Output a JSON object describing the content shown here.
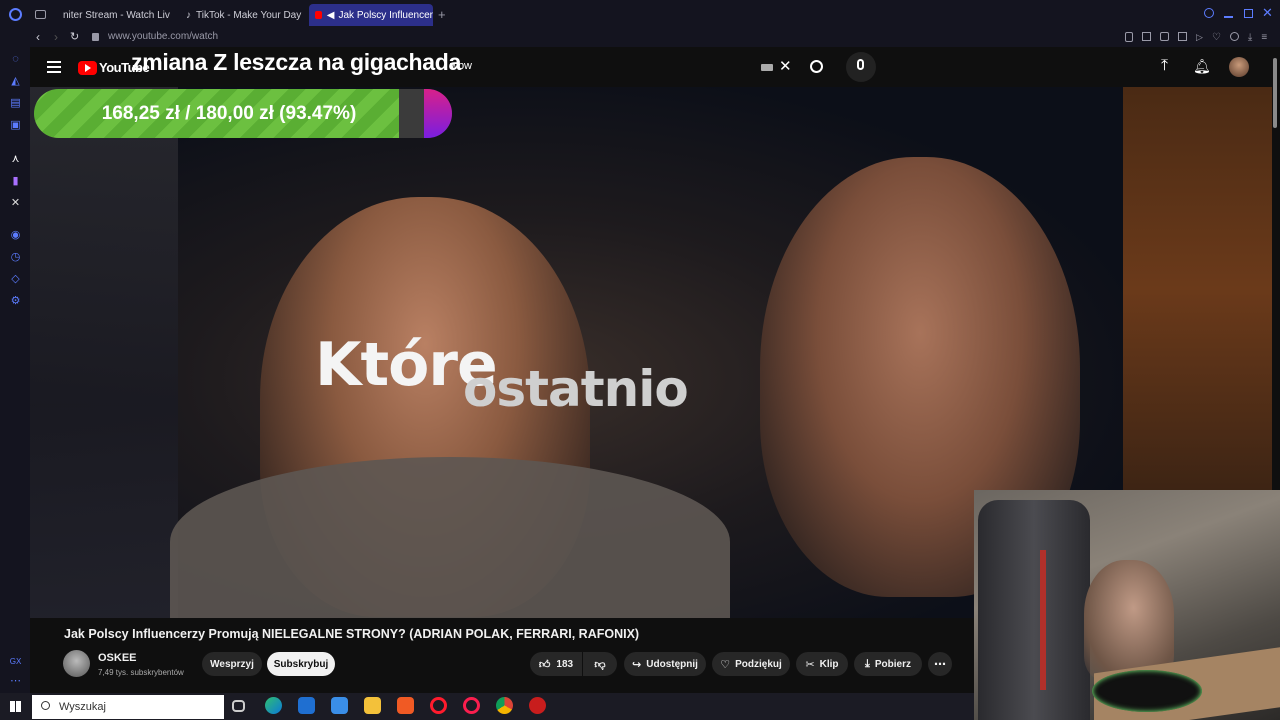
{
  "browser": {
    "tabs": [
      {
        "label": "niter Stream - Watch Live",
        "color": "#53fc18"
      },
      {
        "label": "TikTok - Make Your Day",
        "color": "#ffffff"
      },
      {
        "label": "Jak Polscy Influencer",
        "color": "#ff0000",
        "active": true
      }
    ],
    "url": "www.youtube.com/watch"
  },
  "youtube": {
    "logo": "YouTube",
    "search_suffix": "wbw"
  },
  "stream_overlay": {
    "title": "zmiana Z leszcza na gigachada",
    "donation_text": "168,25 zł / 180,00 zł (93.47%)",
    "donation_progress": 0.9347
  },
  "video": {
    "caption_main": "Które",
    "caption_sub": "ostatnio",
    "title": "Jak Polscy Influencerzy Promują NIELEGALNE STRONY? (ADRIAN POLAK, FERRARI, RAFONIX)"
  },
  "channel": {
    "name": "OSKEE",
    "subs": "7,49 tys. subskrybentów",
    "support_label": "Wesprzyj",
    "subscribe_label": "Subskrybuj"
  },
  "actions": {
    "likes": "183",
    "share": "Udostępnij",
    "thanks": "Podziękuj",
    "clip": "Klip",
    "download": "Pobierz"
  },
  "taskbar": {
    "search_placeholder": "Wyszukaj",
    "brand_color": "#5c7cff"
  }
}
